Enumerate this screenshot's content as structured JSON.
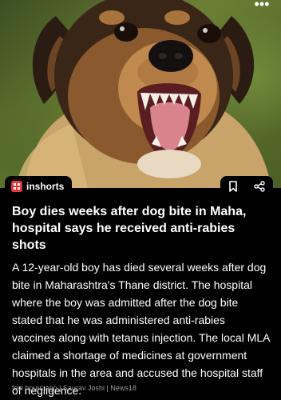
{
  "header": {
    "more_icon": "more-horizontal-icon",
    "more_label": "•••"
  },
  "hero": {
    "image_icon": "dog-photo"
  },
  "brand": {
    "name": "inshorts",
    "logo_icon": "inshorts-logo-icon",
    "accent": "#e8363b"
  },
  "actions": {
    "bookmark_icon": "bookmark-icon",
    "share_icon": "share-icon"
  },
  "article": {
    "headline": "Boy dies weeks after dog bite in Maha, hospital says he received anti-rabies shots",
    "body": "A 12-year-old boy has died several weeks after dog bite in Maharashtra's Thane district. The hospital where the boy was admitted after the dog bite stated that he was administered anti-rabies vaccines along with tetanus injection. The local MLA claimed a shortage of medicines at government hospitals in the area and accused the hospital staff of negligence.",
    "time": "few hours ago",
    "author": "Saurav Joshi",
    "source": "News18",
    "separator": "|"
  }
}
